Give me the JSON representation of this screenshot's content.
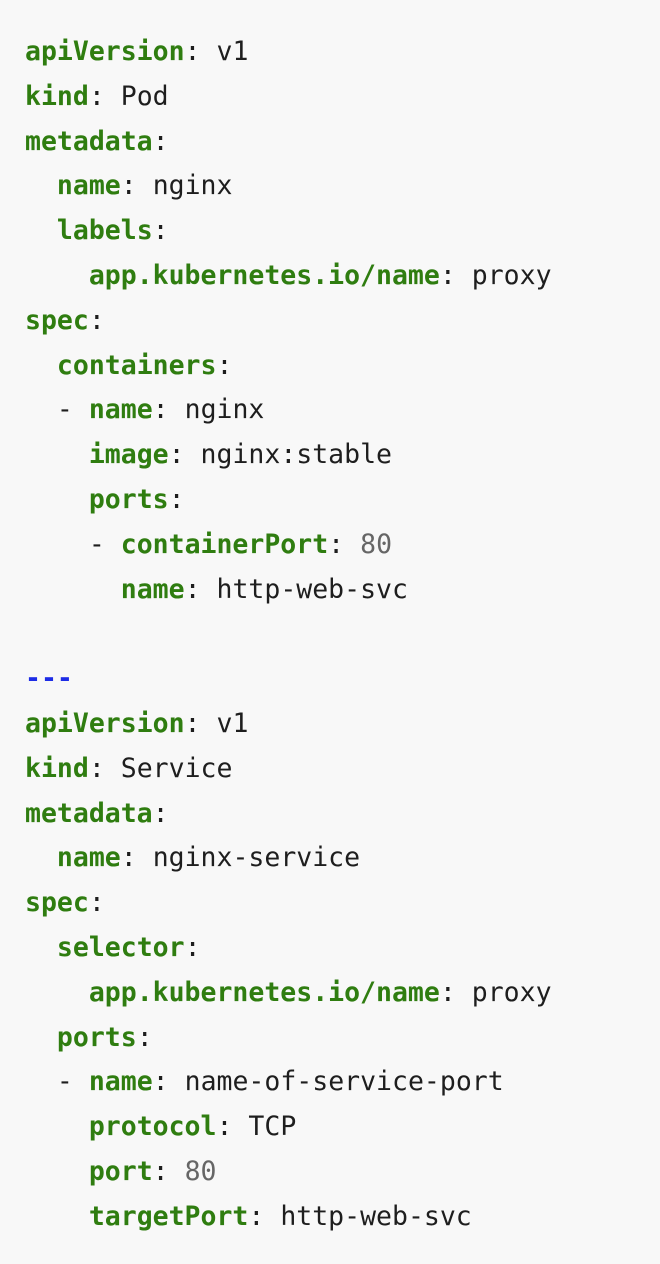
{
  "code": {
    "lines": [
      {
        "indent": "",
        "dash": "",
        "key": "apiVersion",
        "value": "v1",
        "value_type": "string"
      },
      {
        "indent": "",
        "dash": "",
        "key": "kind",
        "value": "Pod",
        "value_type": "string"
      },
      {
        "indent": "",
        "dash": "",
        "key": "metadata",
        "value": "",
        "value_type": "none"
      },
      {
        "indent": "  ",
        "dash": "",
        "key": "name",
        "value": "nginx",
        "value_type": "string"
      },
      {
        "indent": "  ",
        "dash": "",
        "key": "labels",
        "value": "",
        "value_type": "none"
      },
      {
        "indent": "    ",
        "dash": "",
        "key": "app.kubernetes.io/name",
        "value": "proxy",
        "value_type": "string"
      },
      {
        "indent": "",
        "dash": "",
        "key": "spec",
        "value": "",
        "value_type": "none"
      },
      {
        "indent": "  ",
        "dash": "",
        "key": "containers",
        "value": "",
        "value_type": "none"
      },
      {
        "indent": "  ",
        "dash": "- ",
        "key": "name",
        "value": "nginx",
        "value_type": "string"
      },
      {
        "indent": "    ",
        "dash": "",
        "key": "image",
        "value": "nginx:stable",
        "value_type": "string"
      },
      {
        "indent": "    ",
        "dash": "",
        "key": "ports",
        "value": "",
        "value_type": "none"
      },
      {
        "indent": "    ",
        "dash": "- ",
        "key": "containerPort",
        "value": "80",
        "value_type": "number"
      },
      {
        "indent": "      ",
        "dash": "",
        "key": "name",
        "value": "http-web-svc",
        "value_type": "string"
      },
      {
        "type": "blank"
      },
      {
        "type": "separator",
        "text": "---"
      },
      {
        "indent": "",
        "dash": "",
        "key": "apiVersion",
        "value": "v1",
        "value_type": "string"
      },
      {
        "indent": "",
        "dash": "",
        "key": "kind",
        "value": "Service",
        "value_type": "string"
      },
      {
        "indent": "",
        "dash": "",
        "key": "metadata",
        "value": "",
        "value_type": "none"
      },
      {
        "indent": "  ",
        "dash": "",
        "key": "name",
        "value": "nginx-service",
        "value_type": "string"
      },
      {
        "indent": "",
        "dash": "",
        "key": "spec",
        "value": "",
        "value_type": "none"
      },
      {
        "indent": "  ",
        "dash": "",
        "key": "selector",
        "value": "",
        "value_type": "none"
      },
      {
        "indent": "    ",
        "dash": "",
        "key": "app.kubernetes.io/name",
        "value": "proxy",
        "value_type": "string"
      },
      {
        "indent": "  ",
        "dash": "",
        "key": "ports",
        "value": "",
        "value_type": "none"
      },
      {
        "indent": "  ",
        "dash": "- ",
        "key": "name",
        "value": "name-of-service-port",
        "value_type": "string"
      },
      {
        "indent": "    ",
        "dash": "",
        "key": "protocol",
        "value": "TCP",
        "value_type": "string"
      },
      {
        "indent": "    ",
        "dash": "",
        "key": "port",
        "value": "80",
        "value_type": "number"
      },
      {
        "indent": "    ",
        "dash": "",
        "key": "targetPort",
        "value": "http-web-svc",
        "value_type": "string"
      }
    ]
  },
  "colors": {
    "background": "#f8f8f8",
    "key": "#2f7d10",
    "text": "#1e1e1e",
    "number": "#666666",
    "document_separator": "#1d2ce6"
  }
}
